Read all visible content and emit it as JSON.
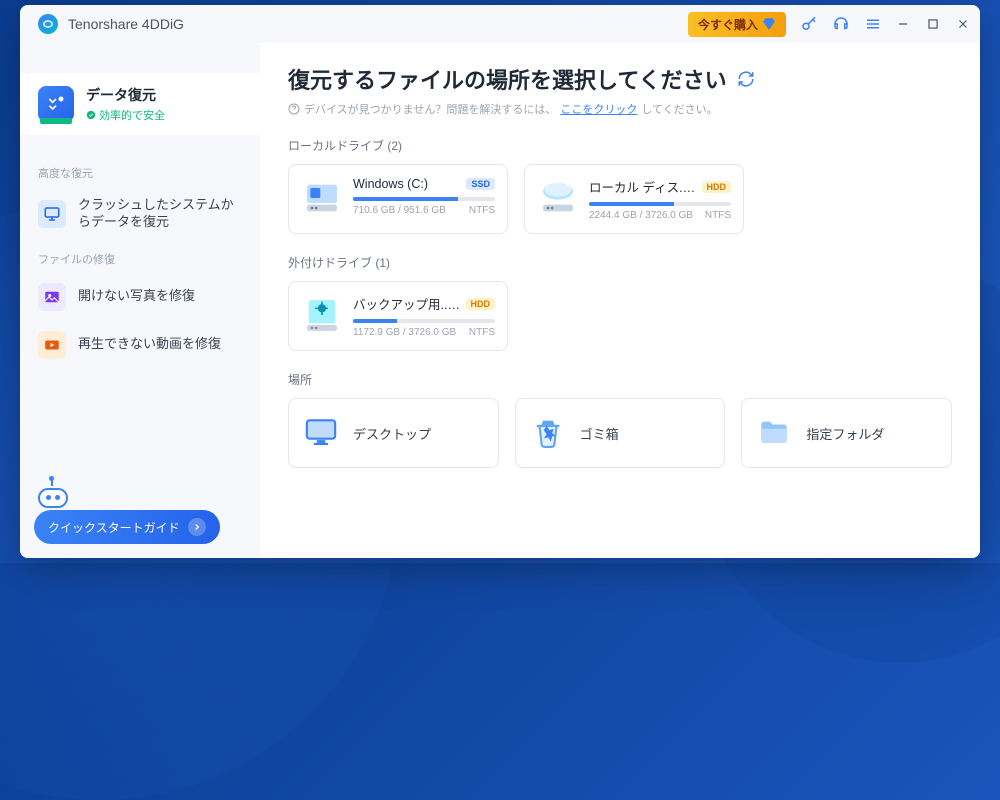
{
  "app": {
    "title": "Tenorshare 4DDiG"
  },
  "titlebar": {
    "buy_now": "今すぐ購入"
  },
  "sidebar": {
    "primary": {
      "title": "データ復元",
      "status": "効率的で安全"
    },
    "section1": "高度な復元",
    "item1": "クラッシュしたシステムからデータを復元",
    "section2": "ファイルの修復",
    "item2": "開けない写真を修復",
    "item3": "再生できない動画を修復",
    "quickstart": "クイックスタートガイド"
  },
  "main": {
    "title": "復元するファイルの場所を選択してください",
    "sub_pre": "デバイスが見つかりません？問題を解決するには、",
    "sub_link": "ここをクリック",
    "sub_post": "してください。",
    "section_local": "ローカルドライブ (2)",
    "section_external": "外付けドライブ (1)",
    "section_location": "場所"
  },
  "drives": {
    "local": [
      {
        "name": "Windows (C:)",
        "tag": "SSD",
        "tag_class": "tag-ssd",
        "used": "710.6 GB / 951.6 GB",
        "fs": "NTFS",
        "fill": 74
      },
      {
        "name": "ローカル ディス... (D:)",
        "tag": "HDD",
        "tag_class": "tag-hdd",
        "used": "2244.4 GB / 3726.0 GB",
        "fs": "NTFS",
        "fill": 60
      }
    ],
    "external": [
      {
        "name": "バックアップ用... (F:)",
        "tag": "HDD",
        "tag_class": "tag-hdd",
        "used": "1172.9 GB / 3726.0 GB",
        "fs": "NTFS",
        "fill": 31
      }
    ]
  },
  "locations": {
    "desktop": "デスクトップ",
    "recycle": "ゴミ箱",
    "folder": "指定フォルダ"
  }
}
